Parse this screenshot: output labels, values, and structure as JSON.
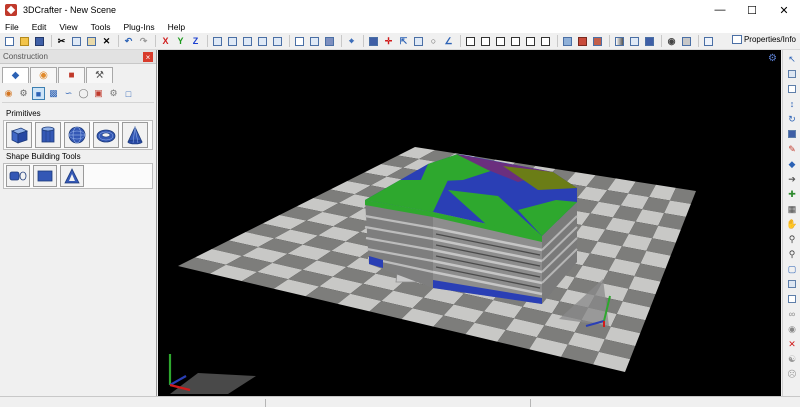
{
  "window": {
    "title": "3DCrafter - New Scene",
    "controls": [
      "minimize-icon",
      "maximize-icon",
      "close-icon"
    ]
  },
  "menu": [
    "File",
    "Edit",
    "View",
    "Tools",
    "Plug-Ins",
    "Help"
  ],
  "toolbar": {
    "axis_labels": [
      "X",
      "Y",
      "Z"
    ],
    "properties_label": "Properties/Info"
  },
  "panel": {
    "title": "Construction",
    "close_label": "×",
    "tabs": [
      "construction-tab-icon",
      "paint-tab-icon",
      "material-tab-icon",
      "tools-tab-icon"
    ],
    "primitives_label": "Primitives",
    "primitives": [
      "cube-icon",
      "cylinder-icon",
      "sphere-icon",
      "torus-icon",
      "cone-icon"
    ],
    "shape_tools_label": "Shape Building Tools",
    "shape_tools": [
      "extrude-icon",
      "box-shape-icon",
      "lathe-icon"
    ]
  },
  "colors": {
    "viewport_bg": "#000000",
    "floor_light": "#c8c8c6",
    "floor_dark": "#7d7d7b",
    "building_blue": "#2a3fb5",
    "building_green": "#2ea82e",
    "building_purple": "#6b2f7e",
    "building_olive": "#6b7d16",
    "building_grey": "#8a8a8a"
  }
}
